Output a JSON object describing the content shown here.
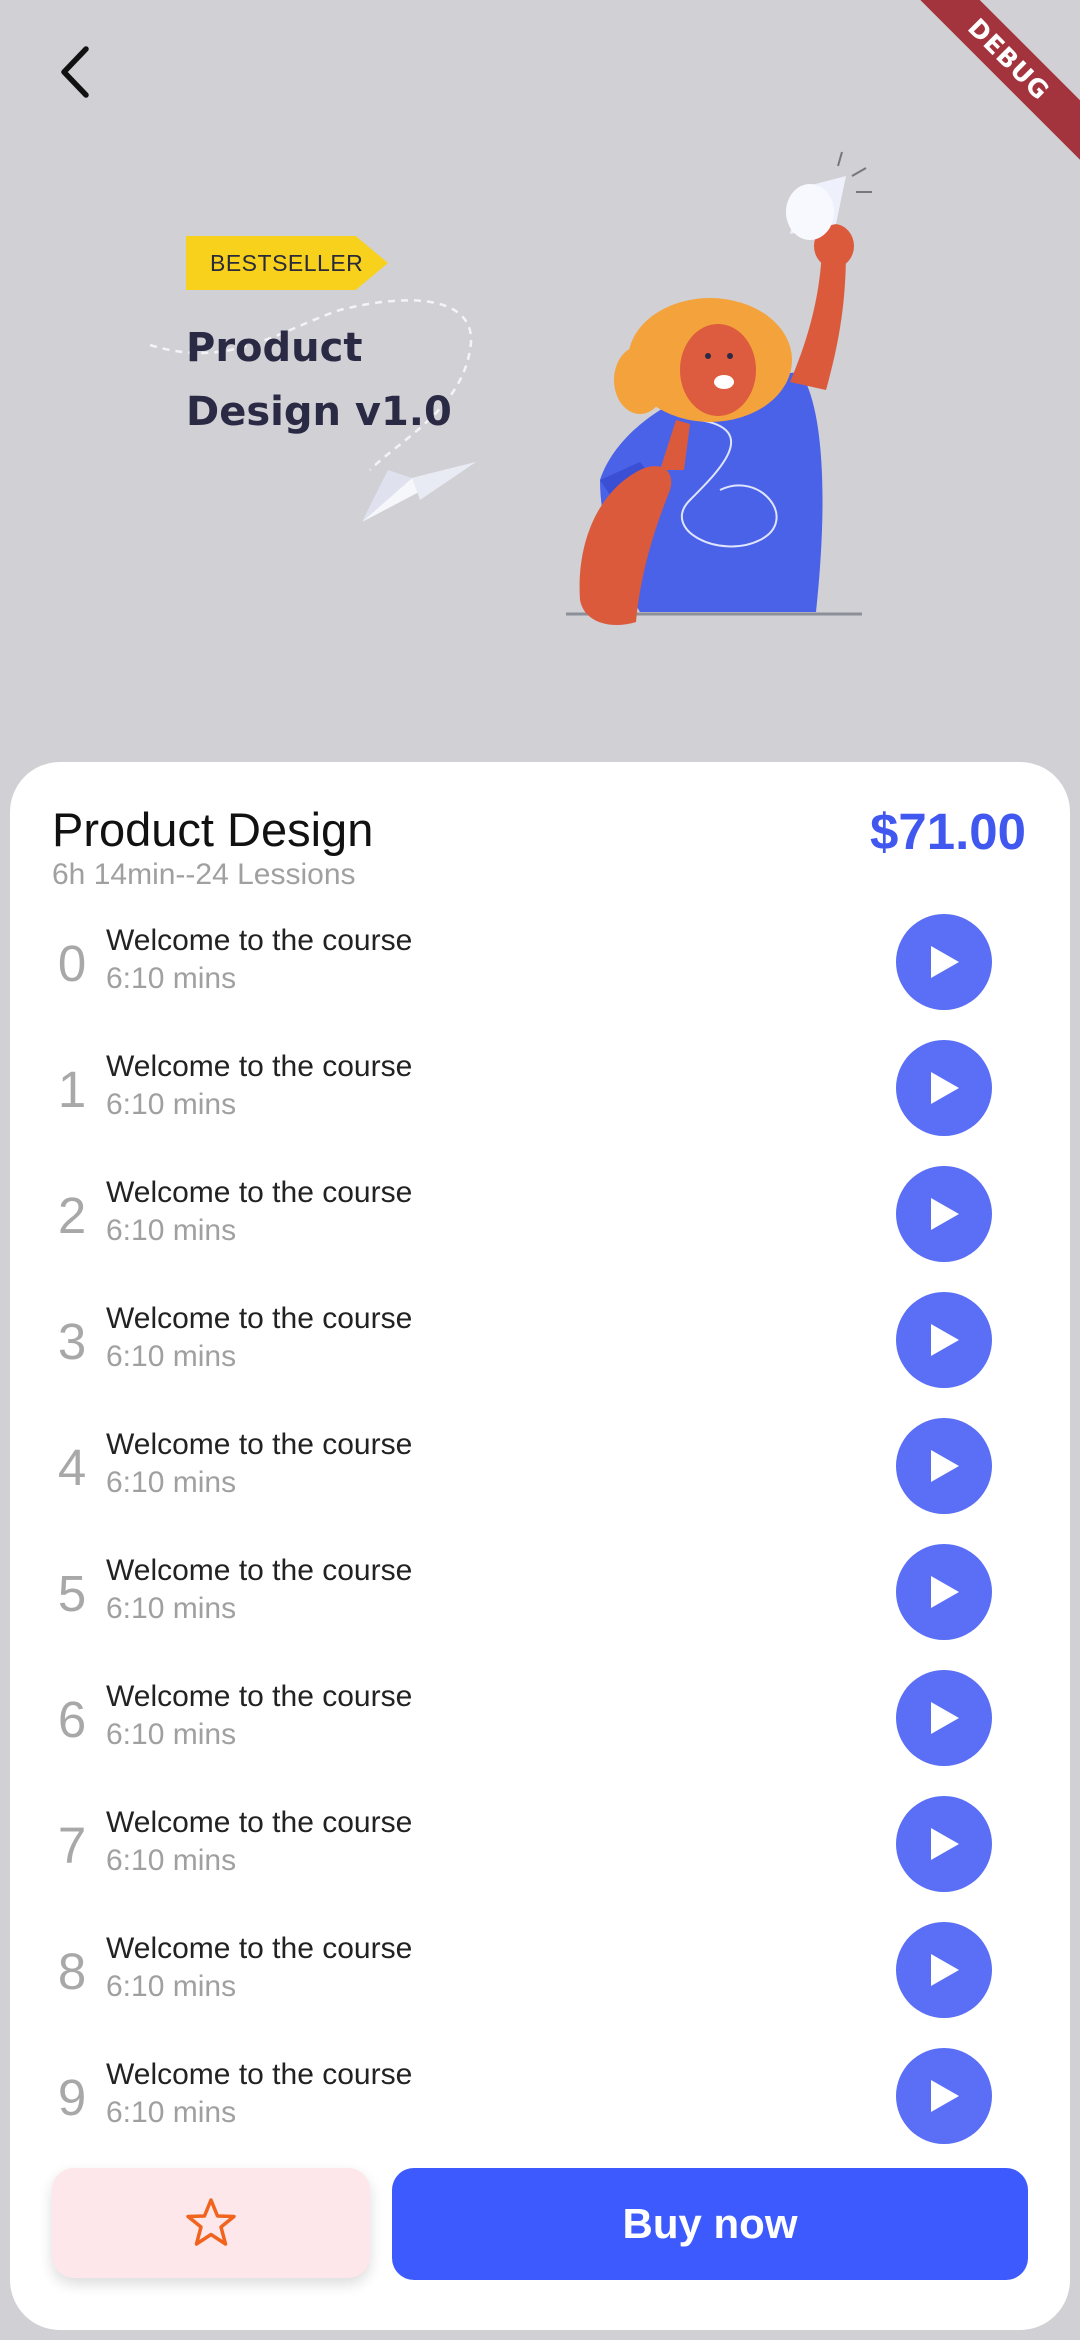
{
  "header": {
    "debug_label": "DEBUG"
  },
  "hero": {
    "badge": "BESTSELLER",
    "title_line1": "Product",
    "title_line2": "Design v1.0"
  },
  "course": {
    "title": "Product Design",
    "meta": "6h 14min--24 Lessions",
    "price": "$71.00"
  },
  "lessons": [
    {
      "number": "0",
      "title": "Welcome to the course",
      "duration": "6:10 mins"
    },
    {
      "number": "1",
      "title": "Welcome to the course",
      "duration": "6:10 mins"
    },
    {
      "number": "2",
      "title": "Welcome to the course",
      "duration": "6:10 mins"
    },
    {
      "number": "3",
      "title": "Welcome to the course",
      "duration": "6:10 mins"
    },
    {
      "number": "4",
      "title": "Welcome to the course",
      "duration": "6:10 mins"
    },
    {
      "number": "5",
      "title": "Welcome to the course",
      "duration": "6:10 mins"
    },
    {
      "number": "6",
      "title": "Welcome to the course",
      "duration": "6:10 mins"
    },
    {
      "number": "7",
      "title": "Welcome to the course",
      "duration": "6:10 mins"
    },
    {
      "number": "8",
      "title": "Welcome to the course",
      "duration": "6:10 mins"
    },
    {
      "number": "9",
      "title": "Welcome to the course",
      "duration": "6:10 mins"
    }
  ],
  "actions": {
    "buy_label": "Buy now"
  },
  "colors": {
    "accent": "#3d5afe",
    "play": "#5a6ff6",
    "price": "#4158f0",
    "favorite_bg": "#fde7ea",
    "favorite_icon": "#f0641e",
    "badge": "#f7d11c"
  },
  "icons": {
    "back": "chevron-left-icon",
    "play": "play-icon",
    "favorite": "star-outline-icon"
  }
}
